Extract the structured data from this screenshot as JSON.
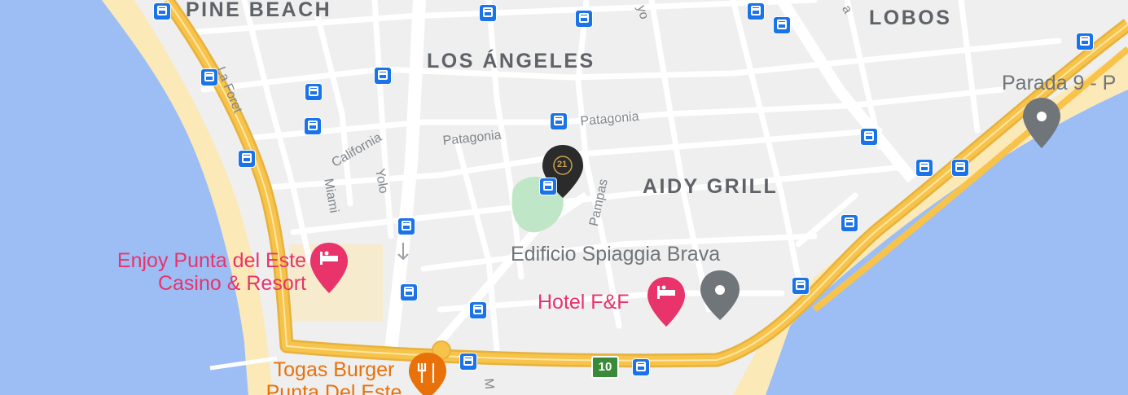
{
  "map": {
    "areas": {
      "pine_beach": "PINE BEACH",
      "lobos": "LOBOS",
      "los_angeles": "LOS ÁNGELES",
      "aidy_grill": "AIDY GRILL"
    },
    "streets": {
      "la_foret": "La Foret",
      "patagonia_1": "Patagonia",
      "patagonia_2": "Patagonia",
      "california": "California",
      "miami": "Miami",
      "yolo": "Yolo",
      "pampas": "Pampas",
      "edge_top_1": "yo",
      "edge_top_2": "a",
      "edge_bottom": "M"
    },
    "places": {
      "parada": "Parada 9 - P",
      "edificio": "Edificio Spiaggia Brava",
      "enjoy_line1": "Enjoy Punta del Este",
      "enjoy_line2": "Casino & Resort",
      "hotel": "Hotel F&F",
      "togas_line1": "Togas Burger",
      "togas_line2": "Punta Del Este"
    },
    "marker": {
      "label": "21"
    },
    "route_shield": "10",
    "icons": {
      "bus_stop": "bus-stop-icon",
      "hotel": "hotel-icon",
      "restaurant": "fork-knife-icon",
      "place": "location-pin-icon",
      "marker": "century21-marker-icon"
    },
    "colors": {
      "water": "#9dbef5",
      "beach": "#fbe9b8",
      "land": "#efefef",
      "highway": "#f8c34a",
      "street": "#ffffff",
      "park": "#bfe6c7",
      "bus": "#1a73e8",
      "hotel_pink": "#e8336b",
      "food_orange": "#e8710a",
      "pin_gray": "#70757a"
    }
  }
}
